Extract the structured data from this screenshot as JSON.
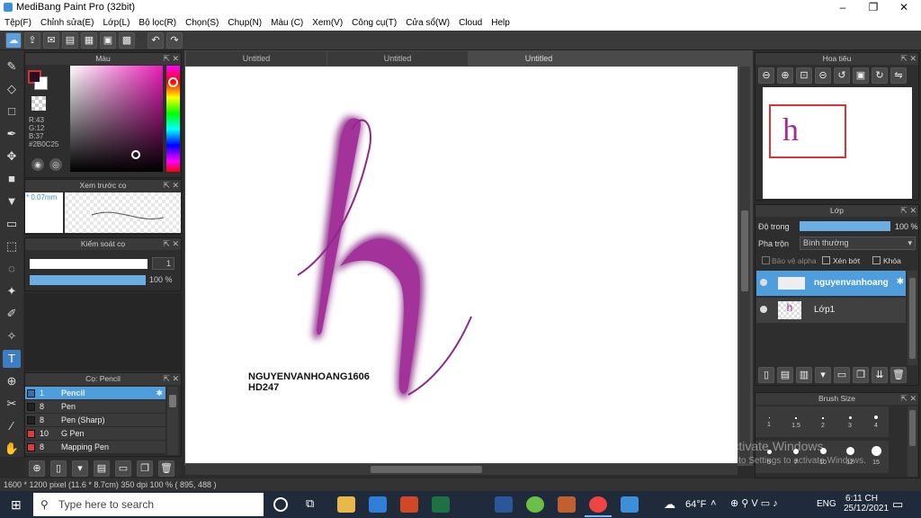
{
  "window": {
    "title": "MediBang Paint Pro (32bit)",
    "minimize": "–",
    "restore": "❐",
    "close": "✕"
  },
  "menu": [
    "Tệp(F)",
    "Chỉnh sửa(E)",
    "Lớp(L)",
    "Bộ lọc(R)",
    "Chọn(S)",
    "Chụp(N)",
    "Màu (C)",
    "Xem(V)",
    "Công cụ(T)",
    "Cửa sổ(W)",
    "Cloud",
    "Help"
  ],
  "tabs": [
    "Untitled",
    "Untitled",
    "Untitled"
  ],
  "color_panel": {
    "title": "Màu",
    "rgb_r": "R:43",
    "rgb_g": "G:12",
    "rgb_b": "B:37",
    "hex": "#2B0C25",
    "primary": "#2b0c25"
  },
  "brush_preview": {
    "title": "Xem trước cọ",
    "size": "* 0.07mm"
  },
  "brush_control": {
    "title": "Kiểm soát cọ",
    "size_value": "1",
    "opacity_value": "100 %"
  },
  "brush_list": {
    "title": "Cọ: Pencil",
    "items": [
      {
        "num": "1",
        "name": "Pencil",
        "color": "#3b6ea8"
      },
      {
        "num": "8",
        "name": "Pen",
        "color": "#222222"
      },
      {
        "num": "8",
        "name": "Pen (Sharp)",
        "color": "#222222"
      },
      {
        "num": "10",
        "name": "G Pen",
        "color": "#e03a3a"
      },
      {
        "num": "8",
        "name": "Mapping Pen",
        "color": "#e03a3a"
      }
    ]
  },
  "canvas": {
    "signature_line1": "NGUYENVANHOANG1606",
    "signature_line2": "HD247",
    "letter": "h"
  },
  "navigator": {
    "title": "Hoa tiêu"
  },
  "layers": {
    "title": "Lớp",
    "opacity_label": "Độ trong",
    "opacity_value": "100 %",
    "blend_label": "Pha trộn",
    "blend_value": "Bình thường",
    "protect_alpha": "Bảo vệ alpha",
    "clipping": "Xén bớt",
    "lock": "Khóa",
    "items": [
      {
        "name": "nguyenvanhoang"
      },
      {
        "name": "Lớp1"
      }
    ]
  },
  "brush_size": {
    "title": "Brush Size",
    "labels": [
      "1",
      "1.5",
      "2",
      "3",
      "4",
      "5",
      "7",
      "10",
      "12",
      "15"
    ]
  },
  "watermark": {
    "line1": "Activate Windows",
    "line2": "Go to Settings to activate Windows."
  },
  "status": {
    "text": "1600 * 1200 pixel   (11.6 * 8.7cm)   350 dpi   100 %   ( 895, 488 )"
  },
  "taskbar": {
    "search_placeholder": "Type here to search",
    "weather": "64°F",
    "lang": "ENG",
    "time": "6:11 CH",
    "date": "25/12/2021"
  }
}
